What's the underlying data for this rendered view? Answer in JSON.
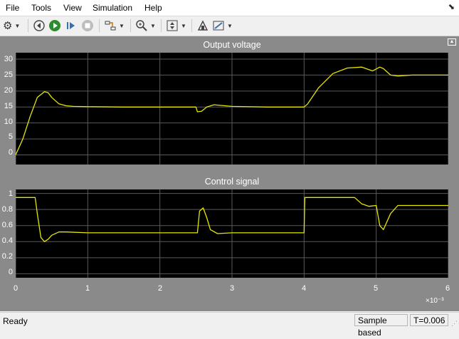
{
  "menu": [
    "File",
    "Tools",
    "View",
    "Simulation",
    "Help"
  ],
  "toolbar": {
    "icons": [
      "settings-icon",
      "step-back-icon",
      "run-icon",
      "step-forward-icon",
      "stop-icon",
      "signal-selector-icon",
      "zoom-icon",
      "fit-axes-icon",
      "highlight-block-icon",
      "style-icon"
    ]
  },
  "plots": [
    {
      "title": "Output voltage",
      "yticks": [
        "30",
        "25",
        "20",
        "15",
        "10",
        "5",
        "0"
      ]
    },
    {
      "title": "Control signal",
      "yticks": [
        "1",
        "0.8",
        "0.6",
        "0.4",
        "0.2",
        "0"
      ]
    }
  ],
  "xaxis": {
    "ticks": [
      "0",
      "1",
      "2",
      "3",
      "4",
      "5",
      "6"
    ],
    "multiplier": "×10⁻³"
  },
  "status": {
    "left": "Ready",
    "mode": "Sample based",
    "time": "T=0.006"
  },
  "chart_data": [
    {
      "type": "line",
      "title": "Output voltage",
      "xlim": [
        0,
        6
      ],
      "ylim": [
        -3,
        32
      ],
      "grid": true,
      "series": [
        {
          "color": "#e6e600",
          "x": [
            0,
            0.1,
            0.2,
            0.3,
            0.4,
            0.45,
            0.5,
            0.6,
            0.7,
            0.8,
            1.0,
            1.5,
            2.0,
            2.5,
            2.52,
            2.58,
            2.65,
            2.75,
            2.9,
            3.0,
            3.5,
            4.0,
            4.05,
            4.2,
            4.4,
            4.6,
            4.8,
            4.95,
            5.05,
            5.1,
            5.2,
            5.3,
            5.5,
            6.0
          ],
          "y": [
            0,
            5,
            12,
            18,
            19.8,
            19.5,
            18,
            16,
            15.4,
            15.2,
            15.1,
            15,
            15,
            15,
            13.5,
            13.7,
            15,
            15.7,
            15.4,
            15.2,
            15,
            15,
            16,
            21,
            25.5,
            27.2,
            27.5,
            26.3,
            27.5,
            27,
            25,
            24.7,
            25,
            25
          ]
        }
      ]
    },
    {
      "type": "line",
      "title": "Control signal",
      "xlim": [
        0,
        6
      ],
      "ylim": [
        -0.05,
        1.05
      ],
      "grid": true,
      "series": [
        {
          "color": "#e6e600",
          "x": [
            0,
            0.27,
            0.3,
            0.35,
            0.4,
            0.45,
            0.5,
            0.6,
            0.7,
            1.0,
            2.0,
            2.52,
            2.55,
            2.6,
            2.65,
            2.7,
            2.8,
            3.0,
            4.0,
            4.01,
            4.7,
            4.8,
            4.9,
            5.0,
            5.05,
            5.1,
            5.2,
            5.3,
            6.0
          ],
          "y": [
            0.95,
            0.95,
            0.75,
            0.45,
            0.4,
            0.43,
            0.48,
            0.52,
            0.52,
            0.51,
            0.51,
            0.51,
            0.78,
            0.82,
            0.7,
            0.55,
            0.5,
            0.51,
            0.51,
            0.95,
            0.95,
            0.87,
            0.84,
            0.85,
            0.6,
            0.55,
            0.75,
            0.85,
            0.85
          ]
        }
      ]
    }
  ]
}
